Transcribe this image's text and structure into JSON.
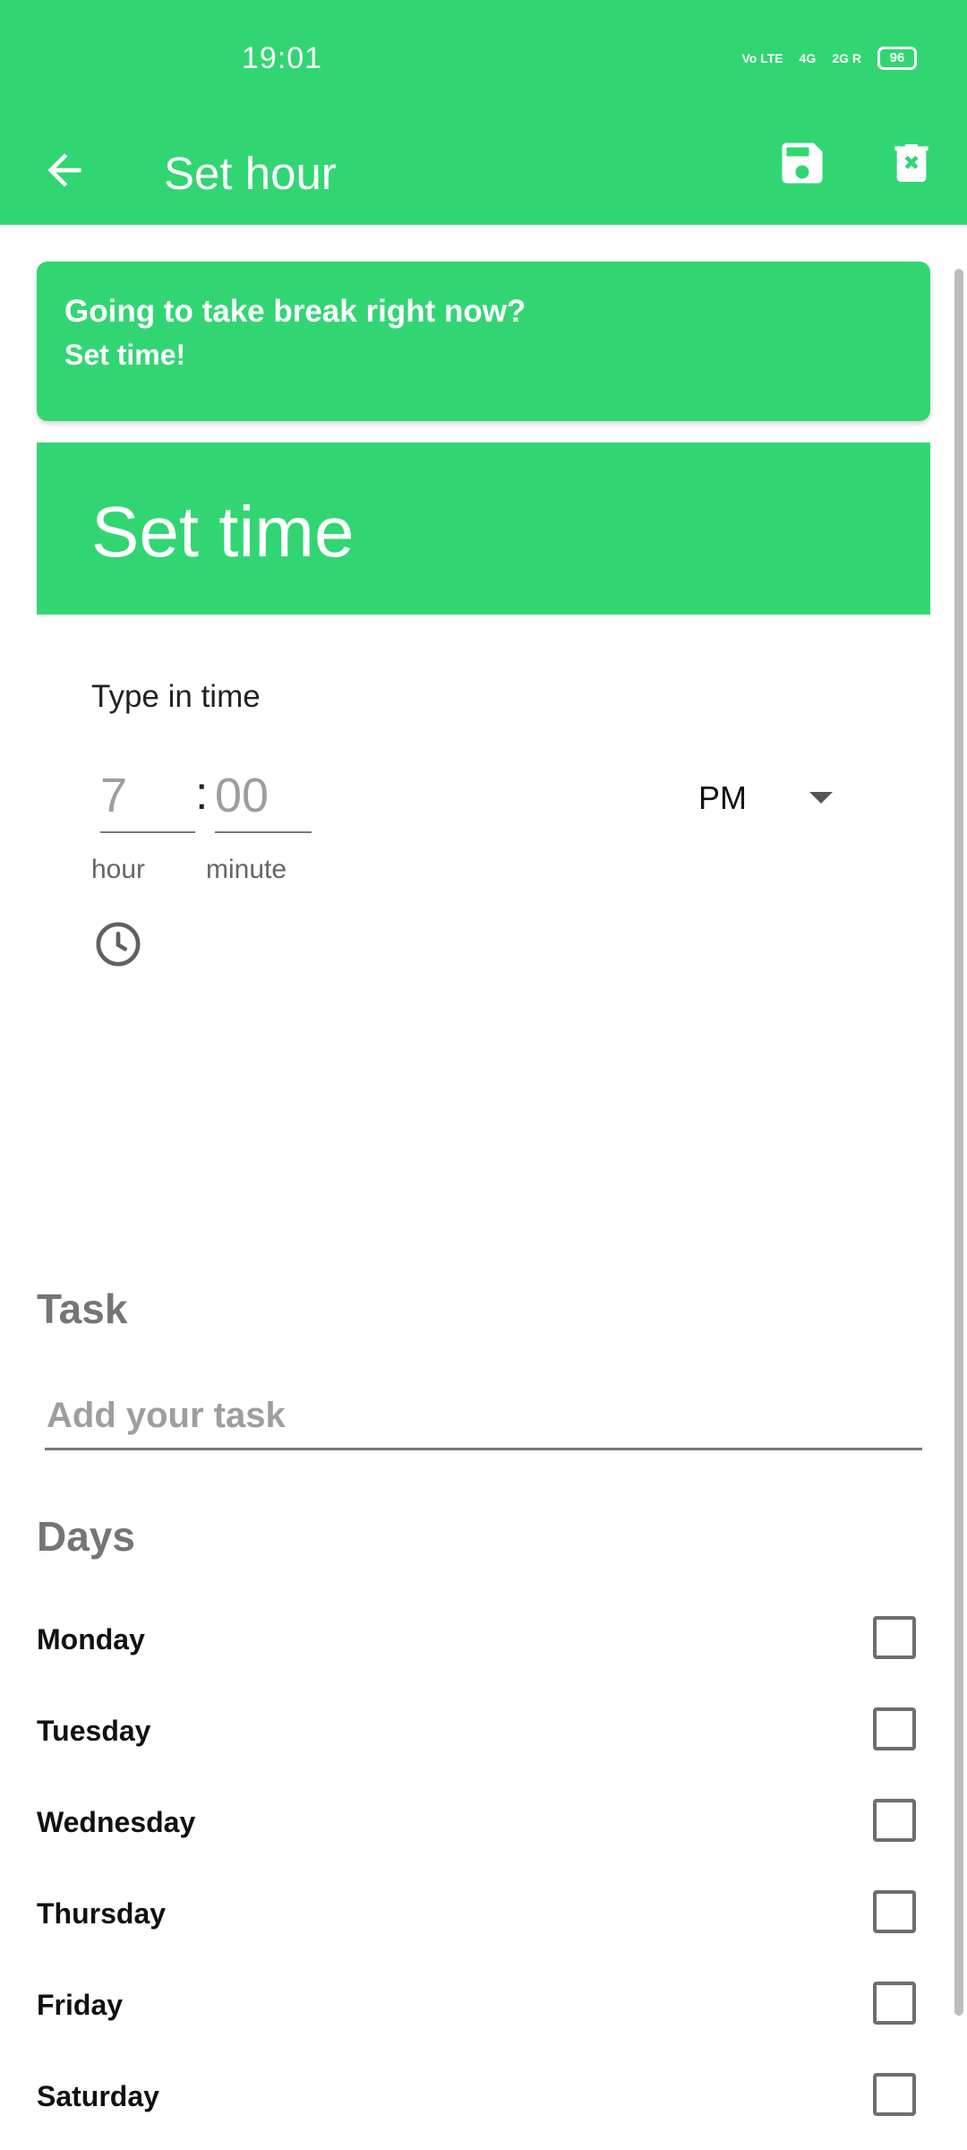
{
  "status_bar": {
    "time": "19:01",
    "signal1": "Vo LTE",
    "signal2": "4G",
    "signal3": "2G R",
    "battery": "96"
  },
  "app_bar": {
    "title": "Set hour",
    "back_icon": "arrow-back-icon",
    "save_icon": "save-icon",
    "delete_icon": "delete-icon"
  },
  "banner": {
    "line1": "Going to take break right now?",
    "line2": "Set time!"
  },
  "set_time": {
    "title": "Set time",
    "type_in_label": "Type in time",
    "hour_value": "7",
    "minute_value": "00",
    "separator": ":",
    "hour_label": "hour",
    "minute_label": "minute",
    "ampm": "PM",
    "clock_icon": "clock-icon"
  },
  "task": {
    "title": "Task",
    "placeholder": "Add your task"
  },
  "days": {
    "title": "Days",
    "items": [
      {
        "label": "Monday",
        "checked": false
      },
      {
        "label": "Tuesday",
        "checked": false
      },
      {
        "label": "Wednesday",
        "checked": false
      },
      {
        "label": "Thursday",
        "checked": false
      },
      {
        "label": "Friday",
        "checked": false
      },
      {
        "label": "Saturday",
        "checked": false
      }
    ]
  },
  "colors": {
    "accent": "#31d673",
    "text_gray": "#757575"
  }
}
